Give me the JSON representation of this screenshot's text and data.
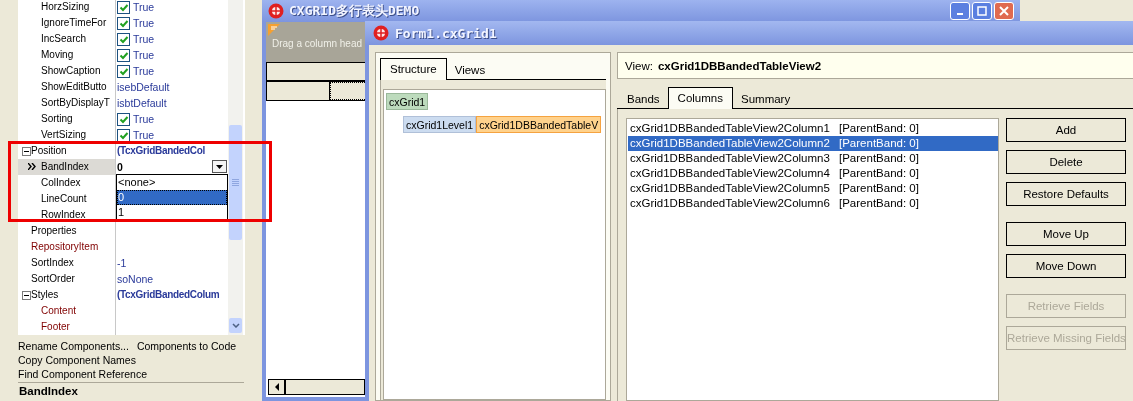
{
  "inspector": {
    "options_rows": [
      {
        "name": "HorzSizing",
        "kind": "check",
        "value": "True",
        "checked": true,
        "selected": false
      },
      {
        "name": "IgnoreTimeFor",
        "kind": "check",
        "value": "True",
        "checked": true,
        "selected": false
      },
      {
        "name": "IncSearch",
        "kind": "check",
        "value": "True",
        "checked": true,
        "selected": false
      },
      {
        "name": "Moving",
        "kind": "check",
        "value": "True",
        "checked": true,
        "selected": false
      },
      {
        "name": "ShowCaption",
        "kind": "check",
        "value": "True",
        "checked": true,
        "selected": false
      },
      {
        "name": "ShowEditButto",
        "kind": "property",
        "value": "isebDefault",
        "selected": false
      },
      {
        "name": "SortByDisplayT",
        "kind": "property",
        "value": "isbtDefault",
        "selected": false
      },
      {
        "name": "Sorting",
        "kind": "check",
        "value": "True",
        "checked": true,
        "selected": false
      },
      {
        "name": "VertSizing",
        "kind": "check",
        "value": "True",
        "checked": true,
        "selected": false
      }
    ],
    "rows": [
      {
        "name": "Position",
        "kind": "property",
        "value": "(TcxGridBandedCol",
        "expanded": true,
        "selected": false,
        "children": [
          {
            "name": "BandIndex",
            "kind": "property",
            "value": "0",
            "selected": true
          },
          {
            "name": "ColIndex",
            "kind": "property",
            "selected": false
          },
          {
            "name": "LineCount",
            "kind": "property",
            "selected": false
          },
          {
            "name": "RowIndex",
            "kind": "property",
            "selected": false
          }
        ]
      },
      {
        "name": "Properties",
        "kind": "property",
        "selected": false
      },
      {
        "name": "RepositoryItem",
        "kind": "reference",
        "selected": false
      },
      {
        "name": "SortIndex",
        "kind": "property",
        "value": "-1",
        "selected": false
      },
      {
        "name": "SortOrder",
        "kind": "property",
        "value": "soNone",
        "selected": false
      },
      {
        "name": "Styles",
        "kind": "property",
        "value": "(TcxGridBandedColum",
        "expanded": true,
        "selected": false,
        "children": [
          {
            "name": "Content",
            "kind": "reference",
            "selected": false
          },
          {
            "name": "Footer",
            "kind": "reference",
            "selected": false
          }
        ]
      }
    ],
    "dropdown": [
      {
        "label": "<none>",
        "selected": false
      },
      {
        "label": "0",
        "selected": true
      },
      {
        "label": "1",
        "selected": false
      }
    ],
    "actions": [
      [
        "Rename Components...",
        "Components to Code"
      ],
      [
        "Copy Component Names"
      ],
      [
        "Find Component Reference"
      ]
    ],
    "status": "BandIndex"
  },
  "demo_window": {
    "title": "CXGRID多行表头DEMO",
    "group_hint": "Drag a column head"
  },
  "editor": {
    "title": "Form1.cxGrid1",
    "left_tabs": [
      {
        "label": "Structure",
        "selected": true
      },
      {
        "label": "Views",
        "selected": false
      }
    ],
    "tree": {
      "label": "cxGrid1",
      "children": [
        {
          "label": "cxGrid1Level1",
          "view": "cxGrid1DBBandedTableV"
        }
      ]
    },
    "view_label": "View:",
    "view_name": "cxGrid1DBBandedTableView2",
    "tabs": [
      {
        "label": "Bands",
        "selected": false
      },
      {
        "label": "Columns",
        "selected": true
      },
      {
        "label": "Summary",
        "selected": false
      }
    ],
    "columns": [
      {
        "name": "cxGrid1DBBandedTableView2Column1",
        "band": "[ParentBand: 0]",
        "selected": false
      },
      {
        "name": "cxGrid1DBBandedTableView2Column2",
        "band": "[ParentBand: 0]",
        "selected": true
      },
      {
        "name": "cxGrid1DBBandedTableView2Column3",
        "band": "[ParentBand: 0]",
        "selected": false
      },
      {
        "name": "cxGrid1DBBandedTableView2Column4",
        "band": "[ParentBand: 0]",
        "selected": false
      },
      {
        "name": "cxGrid1DBBandedTableView2Column5",
        "band": "[ParentBand: 0]",
        "selected": false
      },
      {
        "name": "cxGrid1DBBandedTableView2Column6",
        "band": "[ParentBand: 0]",
        "selected": false
      }
    ],
    "button_groups": [
      [
        {
          "label": "Add",
          "disabled": false
        },
        {
          "label": "Delete",
          "disabled": false
        },
        {
          "label": "Restore Defaults",
          "disabled": false
        }
      ],
      [
        {
          "label": "Move Up",
          "disabled": false
        },
        {
          "label": "Move Down",
          "disabled": false
        }
      ],
      [
        {
          "label": "Retrieve Fields",
          "disabled": true
        },
        {
          "label": "Retrieve Missing Fields",
          "disabled": true
        }
      ]
    ]
  },
  "annotation": {
    "kind": "highlight"
  }
}
